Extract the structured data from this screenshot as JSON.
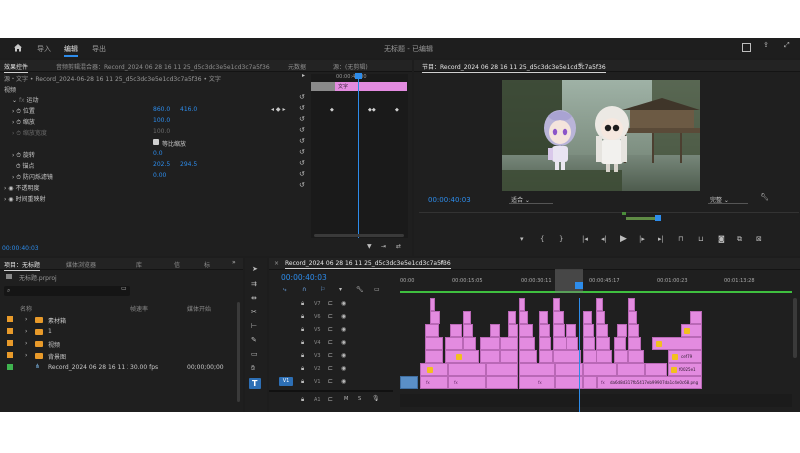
{
  "menu": {
    "tabs": [
      "导入",
      "编辑",
      "导出"
    ],
    "active": "编辑",
    "project_title": "无标题 - 已编辑"
  },
  "effect_controls": {
    "tabs": [
      "效果控件",
      "音频剪辑混合器：Record_2024 06 28 16 11 25_d5c3dc3e5e1cd3c7a5f36",
      "元数据",
      "源：(无剪辑)"
    ],
    "clip_path": "源・文字 • Record_2024-06-28 16 11 25_d5c3dc3e5e1cd3c7a5f36 • 文字",
    "section_video": "视频",
    "motion": "运动",
    "position_label": "位置",
    "position_x": "860.0",
    "position_y": "416.0",
    "scale_label": "缩放",
    "scale_value": "100.0",
    "scale_width_label": "缩放宽度",
    "scale_width_value": "100.0",
    "uniform_scale": "等比缩放",
    "rotation_label": "旋转",
    "rotation_value": "0.0",
    "anchor_label": "锚点",
    "anchor_x": "202.5",
    "anchor_y": "294.5",
    "flicker_label": "防闪烁滤镜",
    "flicker_value": "0.00",
    "opacity_label": "不透明度",
    "time_remap_label": "时间重映射",
    "mini_clip_label": "文字",
    "mini_ruler": "00:00:40:00",
    "timecode": "00:00:40:03"
  },
  "program_monitor": {
    "title": "节目：Record_2024 06 28 16 11 25_d5c3dc3e5e1cd3c7a5f36",
    "timecode": "00:00:40:03",
    "fit": "适合",
    "quality": "完整"
  },
  "project_panel": {
    "tabs": [
      "项目：无标题",
      "媒体浏览器",
      "库",
      "信",
      "标"
    ],
    "project_file": "无标题.prproj",
    "col_name": "名称",
    "col_fps": "帧速率",
    "col_start": "媒体开始",
    "items": [
      {
        "name": "素材箱",
        "kind": "folder"
      },
      {
        "name": "1",
        "kind": "folder"
      },
      {
        "name": "视频",
        "kind": "folder"
      },
      {
        "name": "背景图",
        "kind": "folder"
      },
      {
        "name": "Record_2024 06 28 16 11 2",
        "fps": "30.00 fps",
        "start": "00;00;00;00",
        "kind": "sequence"
      }
    ]
  },
  "timeline": {
    "title": "Record_2024 06 28 16 11 25_d5c3dc3e5e1cd3c7a5f36",
    "timecode": "00:00:40:03",
    "ruler": [
      "00:00",
      "00:00:15:05",
      "00:00:30:11",
      "00:00:45:17",
      "00:01:00:23",
      "00:01:13:28"
    ],
    "tracks": [
      "V7",
      "V6",
      "V5",
      "V4",
      "V3",
      "V2",
      "V1",
      "A1"
    ],
    "active_track": "V1",
    "clip_labels": {
      "v1_main": "da6d8d317fb5417eb99907da1c4e0c68.png",
      "v2_end": "f0025e1",
      "v3_end": "cef79",
      "fx": "fx"
    }
  },
  "colors": {
    "accent": "#2d8ceb",
    "clip": "#e38be0",
    "panel": "#1f1f1f",
    "timecode": "#2d8ceb"
  }
}
